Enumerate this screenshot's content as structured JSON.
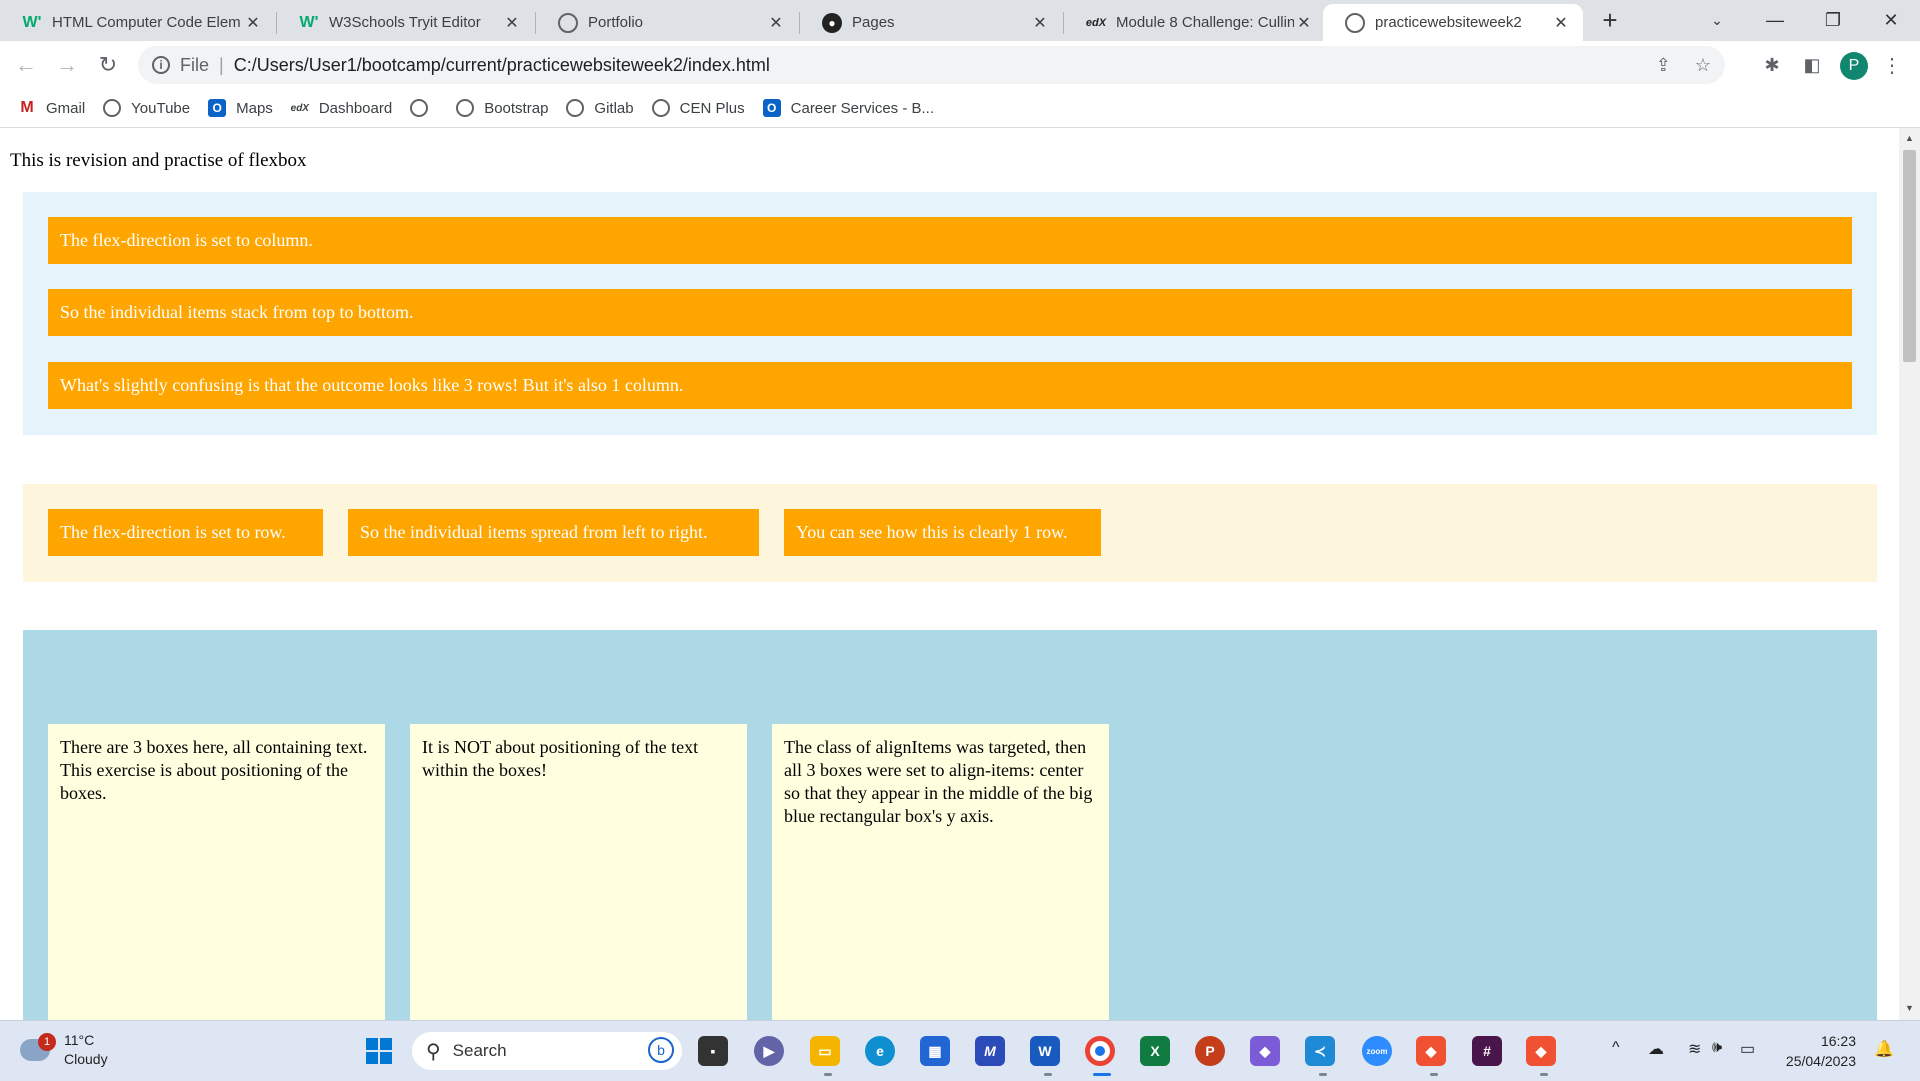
{
  "tabs": [
    {
      "label": "HTML Computer Code Elem",
      "favicon": "W'",
      "favicon_color": "#04aa6d"
    },
    {
      "label": "W3Schools Tryit Editor",
      "favicon": "W'",
      "favicon_color": "#04aa6d"
    },
    {
      "label": "Portfolio",
      "favicon": "globe-icon"
    },
    {
      "label": "Pages",
      "favicon": "github-icon"
    },
    {
      "label": "Module 8 Challenge: Cullin",
      "favicon": "edX"
    },
    {
      "label": "practicewebsiteweek2",
      "favicon": "globe-icon",
      "active": true
    }
  ],
  "address_bar": {
    "scheme_label": "File",
    "url": "C:/Users/User1/bootcamp/current/practicewebsiteweek2/index.html"
  },
  "profile_initial": "P",
  "bookmarks": [
    {
      "label": "Gmail",
      "icon": "gmail-icon"
    },
    {
      "label": "YouTube",
      "icon": "globe-icon"
    },
    {
      "label": "Maps",
      "icon": "outlook-icon"
    },
    {
      "label": "Dashboard",
      "icon": "edx-icon"
    },
    {
      "label": "",
      "icon": "globe-icon"
    },
    {
      "label": "Bootstrap",
      "icon": "globe-icon"
    },
    {
      "label": "Gitlab",
      "icon": "globe-icon"
    },
    {
      "label": "CEN Plus",
      "icon": "globe-icon"
    },
    {
      "label": "Career Services - B...",
      "icon": "outlook-icon"
    }
  ],
  "page": {
    "intro": "This is revision and practise of flexbox",
    "column_items": [
      "The flex-direction is set to column.",
      "So the individual items stack from top to bottom.",
      "What's slightly confusing is that the outcome looks like 3 rows! But it's also 1 column."
    ],
    "row_items": [
      "The flex-direction is set to row.",
      "So the individual items spread from left to right.",
      "You can see how this is clearly 1 row."
    ],
    "align_boxes": [
      "There are 3 boxes here, all containing text. This exercise is about positioning of the boxes.",
      "It is NOT about positioning of the text within the boxes!",
      "The class of alignItems was targeted, then all 3 boxes were set to align-items: center so that they appear in the middle of the big blue rectangular box's y axis."
    ]
  },
  "taskbar": {
    "weather_temp": "11°C",
    "weather_desc": "Cloudy",
    "weather_badge": "1",
    "search_placeholder": "Search",
    "time": "16:23",
    "date": "25/04/2023"
  }
}
